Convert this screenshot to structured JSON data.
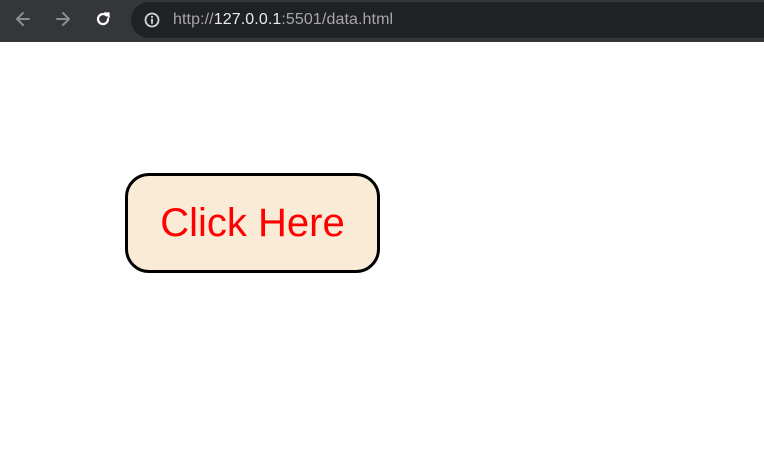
{
  "browser": {
    "url": {
      "scheme": "http://",
      "host": "127.0.0.1",
      "rest": ":5501/data.html"
    },
    "icons": {
      "back": "arrow-left-icon",
      "forward": "arrow-right-icon",
      "reload": "reload-icon",
      "site_info": "info-icon"
    },
    "colors": {
      "toolbar_background": "#35363a",
      "omnibox_background": "#202124"
    }
  },
  "page": {
    "button": {
      "label": "Click Here",
      "text_color": "#ff0000",
      "background_color": "#faebd7",
      "border_color": "#000000"
    }
  }
}
